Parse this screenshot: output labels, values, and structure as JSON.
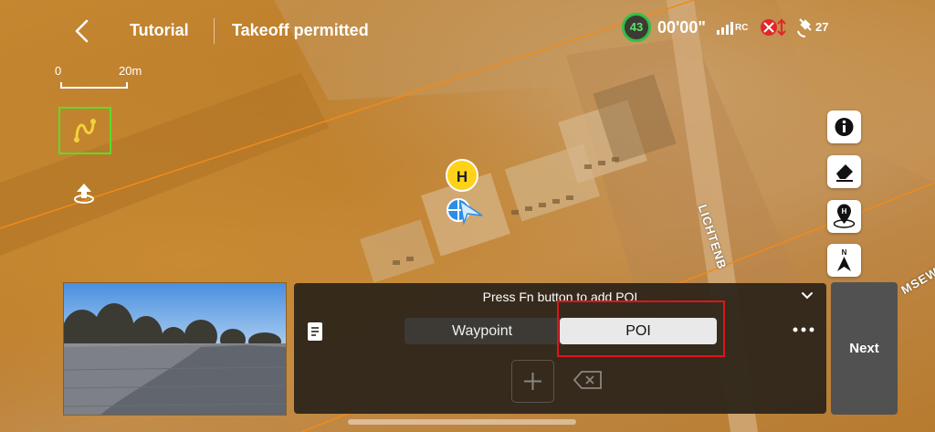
{
  "header": {
    "back_icon": "chevron-left-icon",
    "tutorial_label": "Tutorial",
    "status_text": "Takeoff permitted",
    "battery_percent": "43",
    "flight_time": "00'00\"",
    "rc_signal_label": "RC",
    "satellite_count": "27"
  },
  "map": {
    "scale_min": "0",
    "scale_max": "20m",
    "home_marker_label": "H",
    "street_label_1": "LICHTENB",
    "street_label_2": "MSEW"
  },
  "side_tools": {
    "info_icon": "info-icon",
    "eraser_icon": "eraser-icon",
    "home_point_icon": "home-point-icon",
    "compass_label": "N"
  },
  "panel": {
    "hint": "Press Fn button to add POI",
    "segments": {
      "waypoint": "Waypoint",
      "poi": "POI"
    },
    "selected": "POI",
    "highlight_color": "#e0141a"
  },
  "next_label": "Next",
  "colors": {
    "accent_green": "#5bdc2a",
    "battery_green": "#2fbf4a",
    "panel_bg": "#2d2419"
  }
}
